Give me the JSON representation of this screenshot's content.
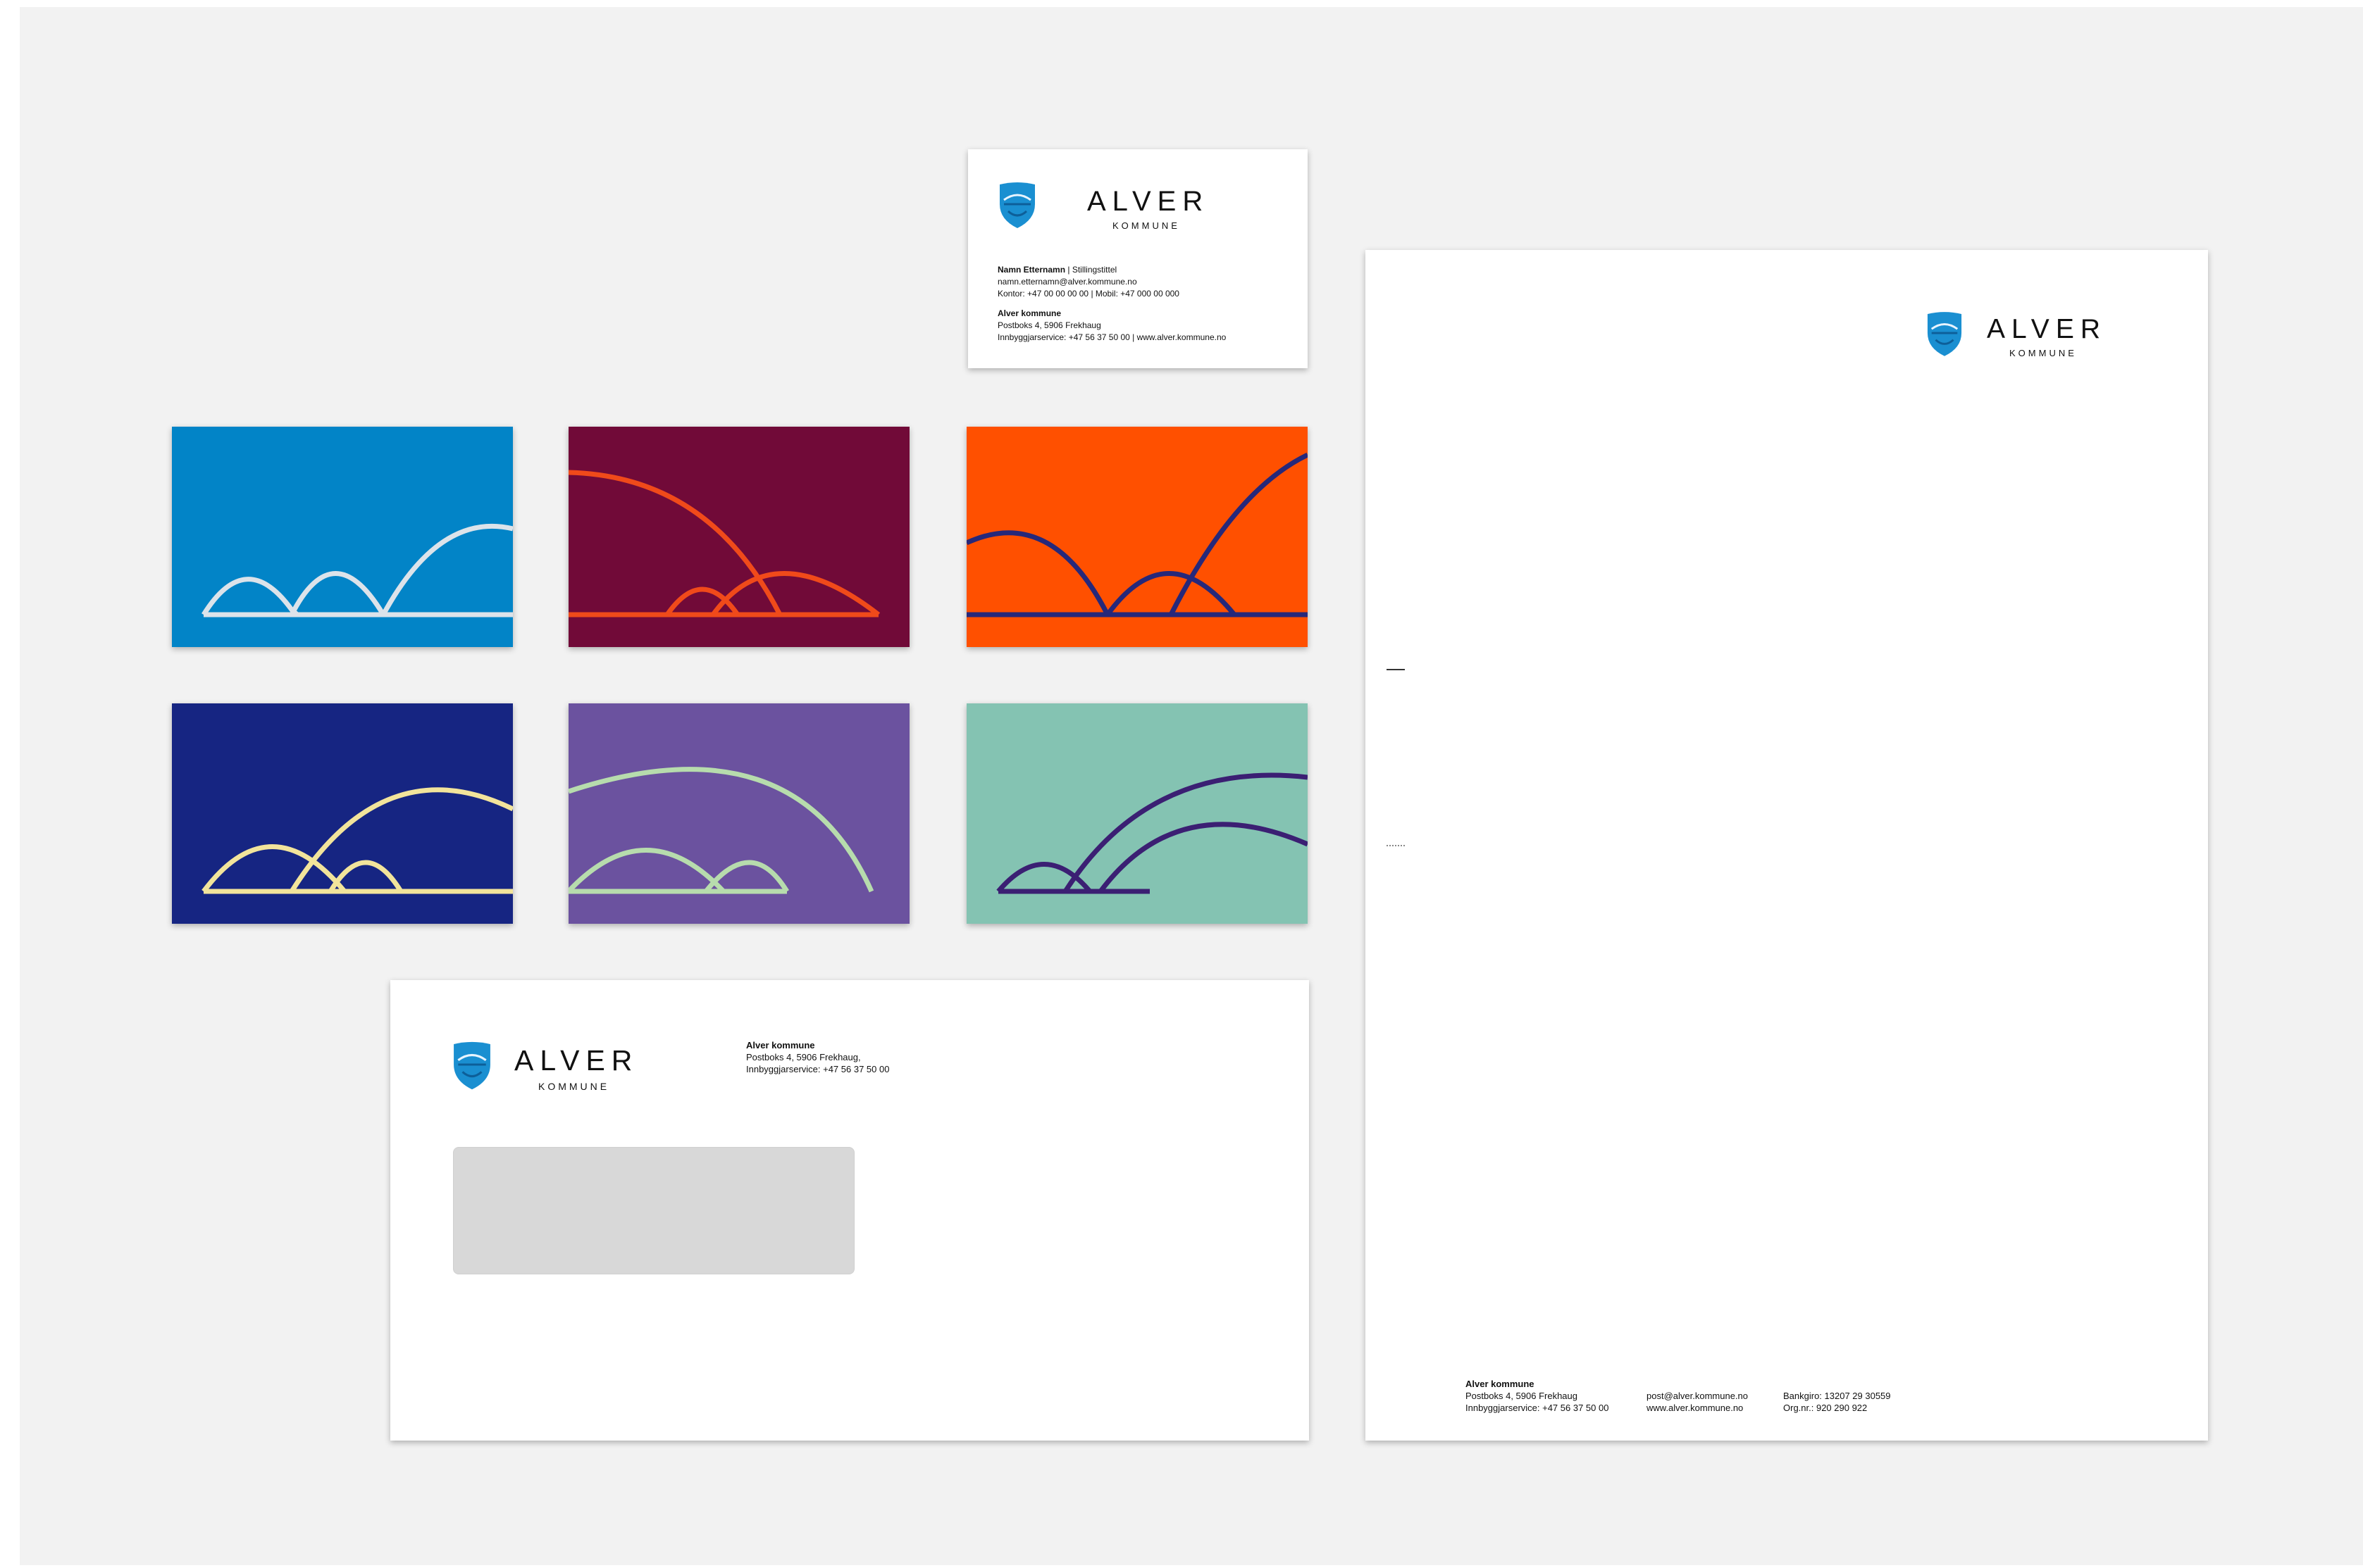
{
  "brand": {
    "name": "ALVER",
    "subname": "KOMMUNE",
    "colors": {
      "shield_blue": "#1a8fd1",
      "shield_dark": "#0d5f99",
      "text": "#111111",
      "backdrop": "#f2f2f2"
    }
  },
  "business_card": {
    "name": "Namn Etternamn",
    "title_sep": " | Stillingstittel",
    "email": "namn.etternamn@alver.kommune.no",
    "phones": "Kontor: +47 00 00 00 00 | Mobil: +47 000 00 000",
    "org": "Alver kommune",
    "address": "Postboks 4, 5906 Frekhaug",
    "service": "Innbyggjarservice: +47 56 37 50 00 | www.alver.kommune.no"
  },
  "envelope": {
    "org": "Alver kommune",
    "address": "Postboks 4, 5906 Frekhaug,",
    "service": "Innbyggjarservice: +47 56 37 50 00"
  },
  "letterhead": {
    "footer": {
      "org": "Alver kommune",
      "address": "Postboks 4, 5906 Frekhaug",
      "service": "Innbyggjarservice: +47 56 37 50 00",
      "email": "post@alver.kommune.no",
      "web": "www.alver.kommune.no",
      "bank": "Bankgiro: 13207 29 30559",
      "orgnr": "Org.nr.: 920 290 922"
    }
  },
  "pattern_cards": [
    {
      "background": "#0284c7",
      "stroke": "#dce3ea"
    },
    {
      "background": "#710a38",
      "stroke": "#f04a1a"
    },
    {
      "background": "#ff5000",
      "stroke": "#26287a"
    },
    {
      "background": "#162582",
      "stroke": "#f2e49b"
    },
    {
      "background": "#6b529f",
      "stroke": "#b7dcad"
    },
    {
      "background": "#84c3b2",
      "stroke": "#3b1f73"
    }
  ]
}
